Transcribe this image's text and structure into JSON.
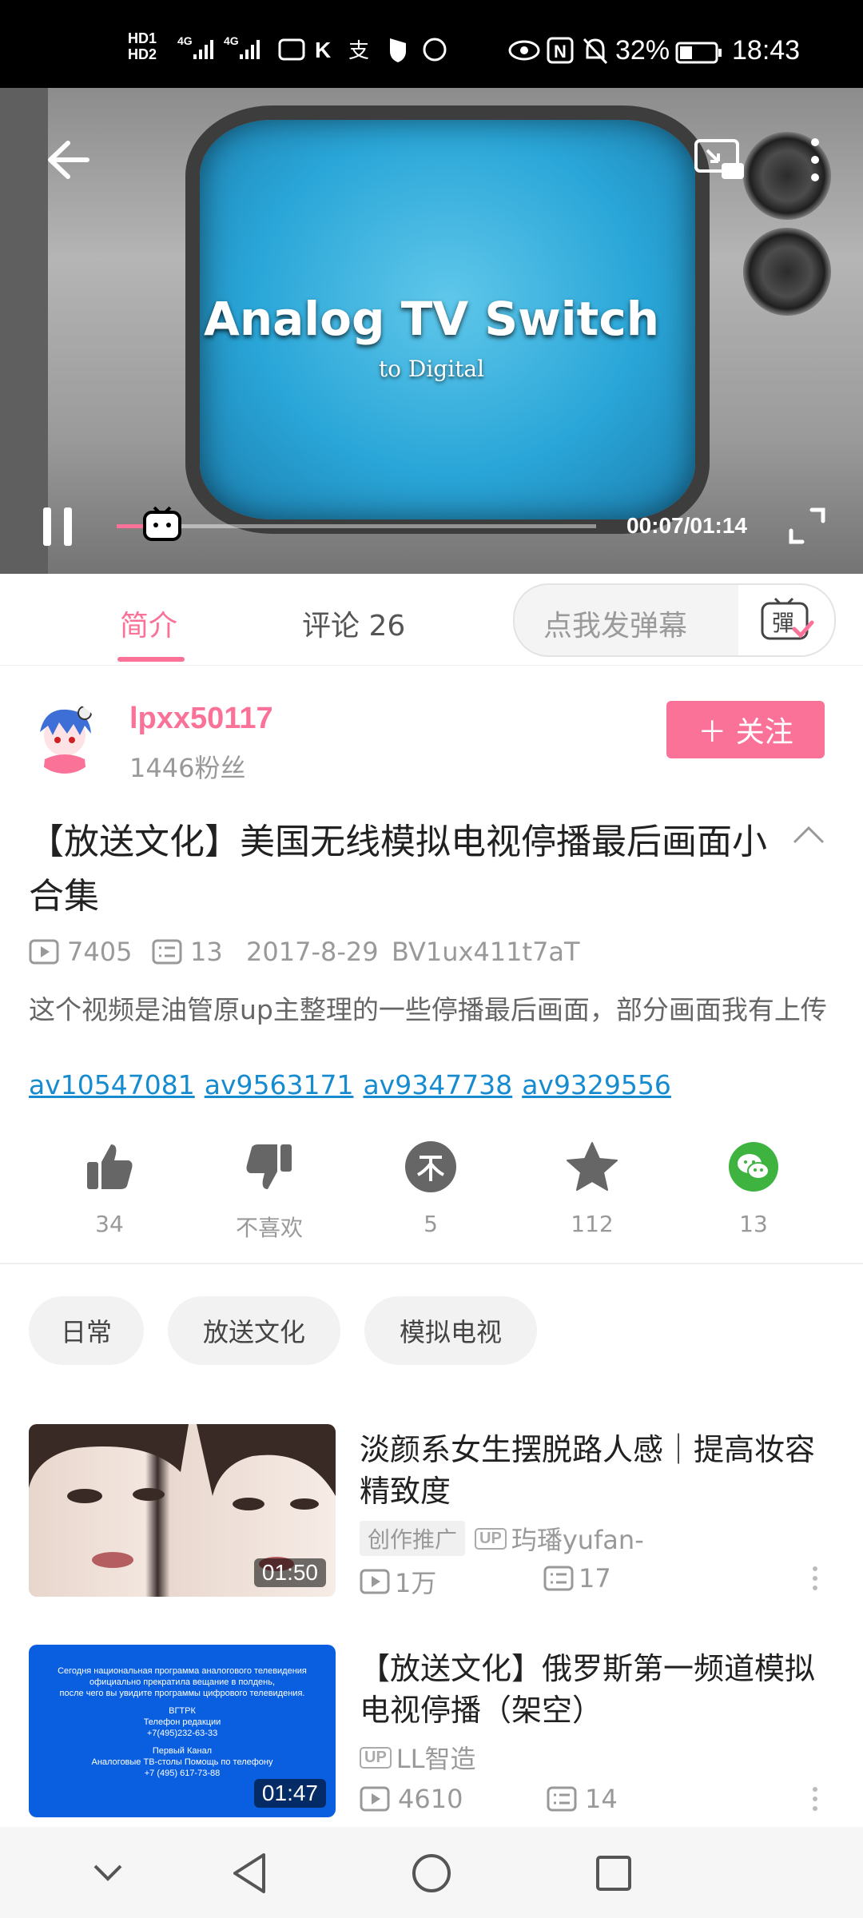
{
  "status_bar": {
    "hd1": "HD1",
    "hd2": "HD2",
    "net1": "4G",
    "net2": "4G",
    "battery": "32%",
    "time": "18:43"
  },
  "video": {
    "title_line1": "Analog TV Switch",
    "title_line2": "to Digital",
    "time": "00:07/01:14",
    "progress": 0.095
  },
  "tabs": [
    {
      "label": "简介",
      "active": true
    },
    {
      "label": "评论 26",
      "active": false
    }
  ],
  "danmaku": {
    "placeholder": "点我发弹幕",
    "icon_text": "彈"
  },
  "uploader": {
    "name": "lpxx50117",
    "fans": "1446粉丝",
    "follow_label": "＋ 关注"
  },
  "title": "【放送文化】美国无线模拟电视停播最后画面小合集",
  "meta": {
    "views": "7405",
    "danmaku_count": "13",
    "date": "2017-8-29",
    "bvid": "BV1ux411t7aT"
  },
  "description": "这个视频是油管原up主整理的一些停播最后画面，部分画面我有上传",
  "av_links": [
    "av10547081",
    "av9563171",
    "av9347738",
    "av9329556"
  ],
  "actions": [
    {
      "name": "like",
      "label": "34"
    },
    {
      "name": "dislike",
      "label": "不喜欢"
    },
    {
      "name": "coin",
      "label": "5"
    },
    {
      "name": "favorite",
      "label": "112"
    },
    {
      "name": "share-wechat",
      "label": "13"
    }
  ],
  "tags": [
    "日常",
    "放送文化",
    "模拟电视"
  ],
  "related": [
    {
      "title": "淡颜系女生摆脱路人感｜提高妆容精致度",
      "duration": "01:50",
      "promo": "创作推广",
      "up_badge": "UP",
      "uploader": "玙璠yufan-",
      "views": "1万",
      "danmaku": "17"
    },
    {
      "title": "【放送文化】俄罗斯第一频道模拟电视停播（架空）",
      "duration": "01:47",
      "up_badge": "UP",
      "uploader": "LL智造",
      "views": "4610",
      "danmaku": "14",
      "thumb_text": [
        "Сегодня национальная программа аналогового телевидения",
        "официально прекратила вещание в полдень,",
        "после чего вы увидите программы цифрового телевидения.",
        "ВГТРК",
        "Телефон редакции",
        "+7(495)232-63-33",
        "Первый Канал",
        "Аналоговые ТВ-столы Помощь по телефону",
        "+7 (495) 617-73-88"
      ]
    }
  ],
  "colors": {
    "accent": "#fb7299",
    "link": "#178bcf",
    "wechat": "#3fb33f"
  }
}
